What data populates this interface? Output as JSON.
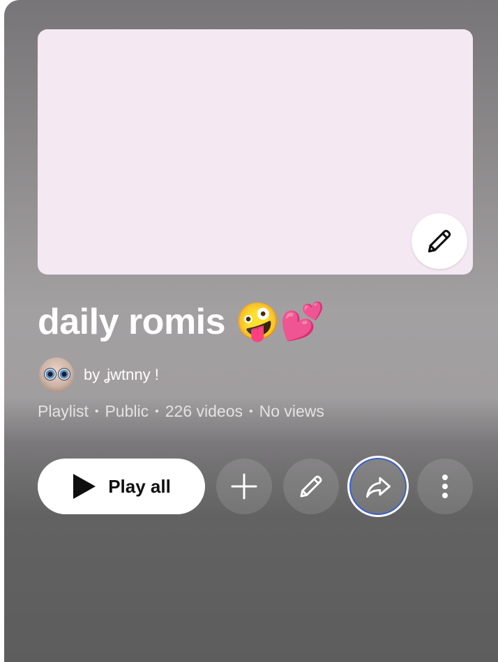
{
  "playlist": {
    "title": "daily romis 🤪💕",
    "owner_prefix": "by",
    "owner_name": "ʝwtnny !",
    "meta": [
      "Playlist",
      "Public",
      "226 videos",
      "No views"
    ],
    "thumbnail_color": "#f4e9f2"
  },
  "actions": {
    "play_all_label": "Play all",
    "buttons": [
      "plus-icon",
      "pencil-icon",
      "share-icon",
      "more-vertical-icon"
    ]
  },
  "colors": {
    "focus_ring": "#3a5fcd",
    "text": "#ffffff"
  }
}
